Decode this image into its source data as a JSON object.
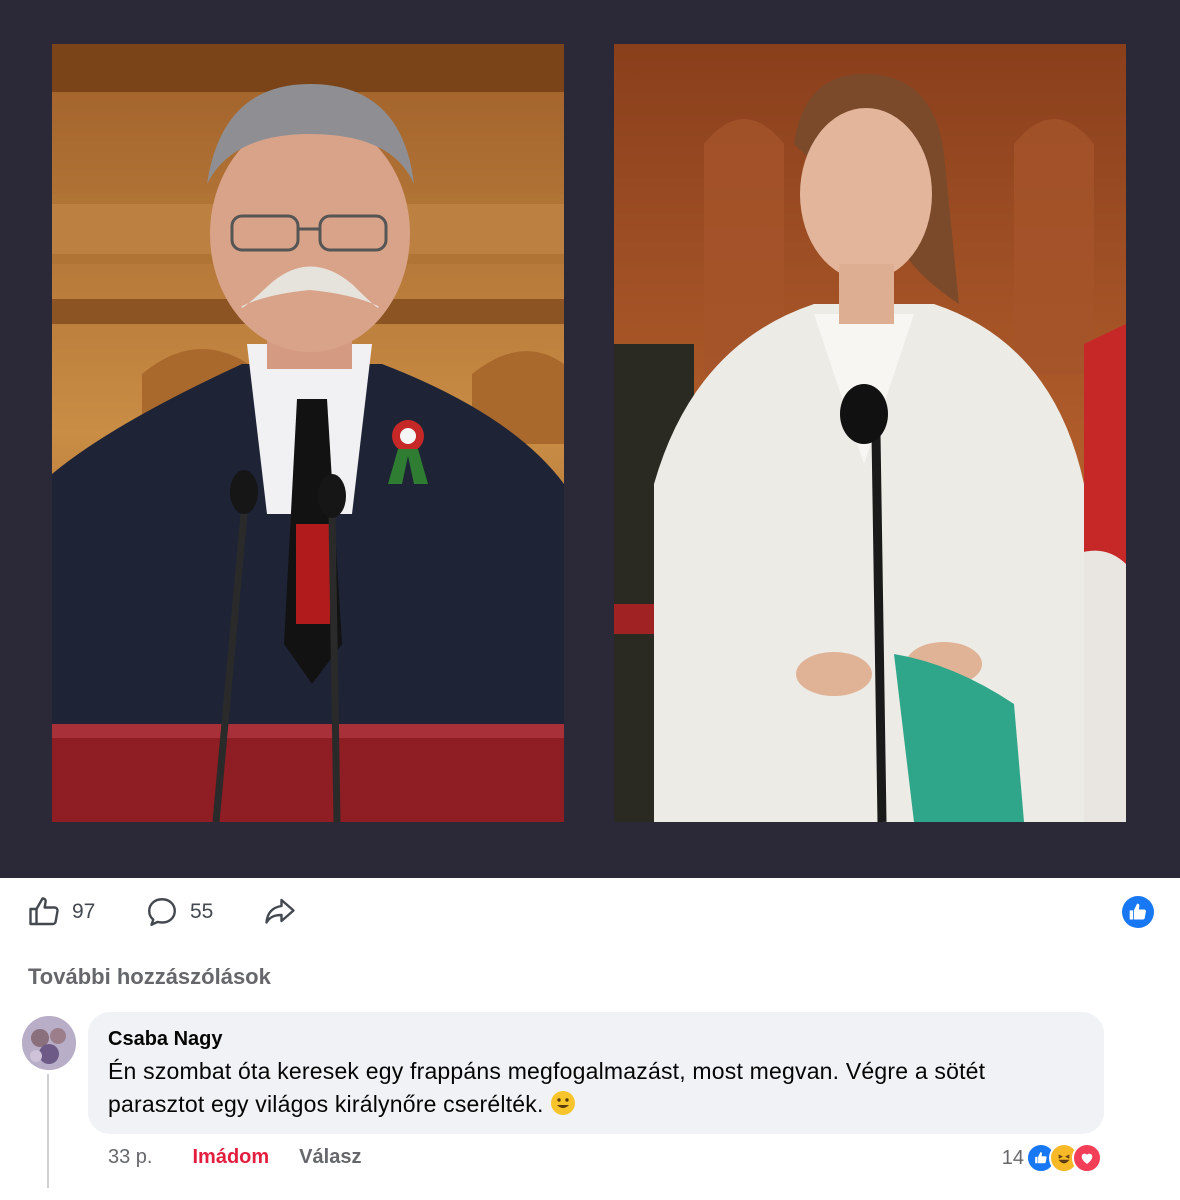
{
  "post": {
    "image_alt_left": "",
    "image_alt_right": ""
  },
  "actions": {
    "like_count": "97",
    "comment_count": "55"
  },
  "comments": {
    "more_label": "További hozzászólások",
    "items": [
      {
        "author": "Csaba Nagy",
        "text": "Én szombat óta keresek egy frappáns megfogalmazást, most megvan. Végre a sötét parasztot egy világos királynőre cserélték.",
        "time": "33 p.",
        "reaction_label": "Imádom",
        "reply_label": "Válasz",
        "reaction_count": "14"
      }
    ]
  },
  "colors": {
    "image_frame": "#2b2838",
    "brand_blue": "#1877f2",
    "love_red": "#e41e3f",
    "bubble_bg": "#f0f2f5"
  },
  "icons": [
    "thumbs-up-icon",
    "comment-icon",
    "share-icon",
    "like-badge-icon",
    "smile-emoji-icon",
    "haha-icon",
    "love-icon"
  ]
}
